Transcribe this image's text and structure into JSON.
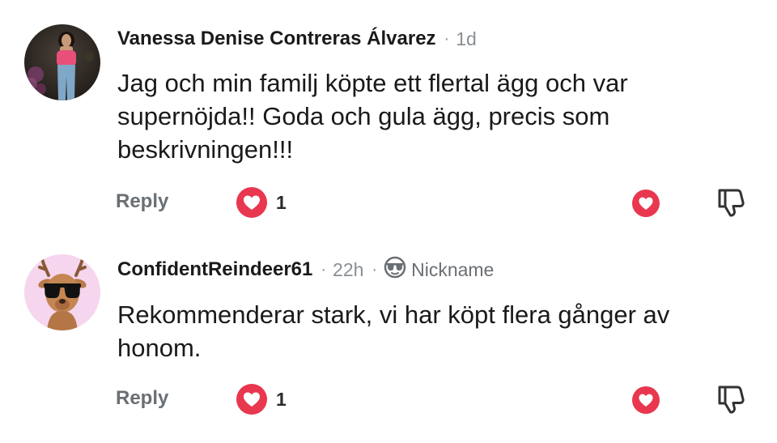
{
  "comments": [
    {
      "username": "Vanessa Denise Contreras Álvarez",
      "separator": "·",
      "time": "1d",
      "body": "Jag och min familj köpte ett flertal ägg och var supernöjda!! Goda och gula ägg, precis som beskrivningen!!!",
      "reply_label": "Reply",
      "like_count": "1",
      "avatar": "photo-avatar"
    },
    {
      "username": "ConfidentReindeer61",
      "separator": "·",
      "time": "22h",
      "flair_icon": "sunglasses-face-icon",
      "flair_label": "Nickname",
      "body": "Rekommenderar stark, vi har köpt flera gånger av honom.",
      "reply_label": "Reply",
      "like_count": "1",
      "avatar": "reindeer-avatar"
    }
  ],
  "colors": {
    "like": "#e8374f",
    "muted_text": "#8a8f94",
    "reindeer_avatar_bg": "#f6d6ee"
  }
}
